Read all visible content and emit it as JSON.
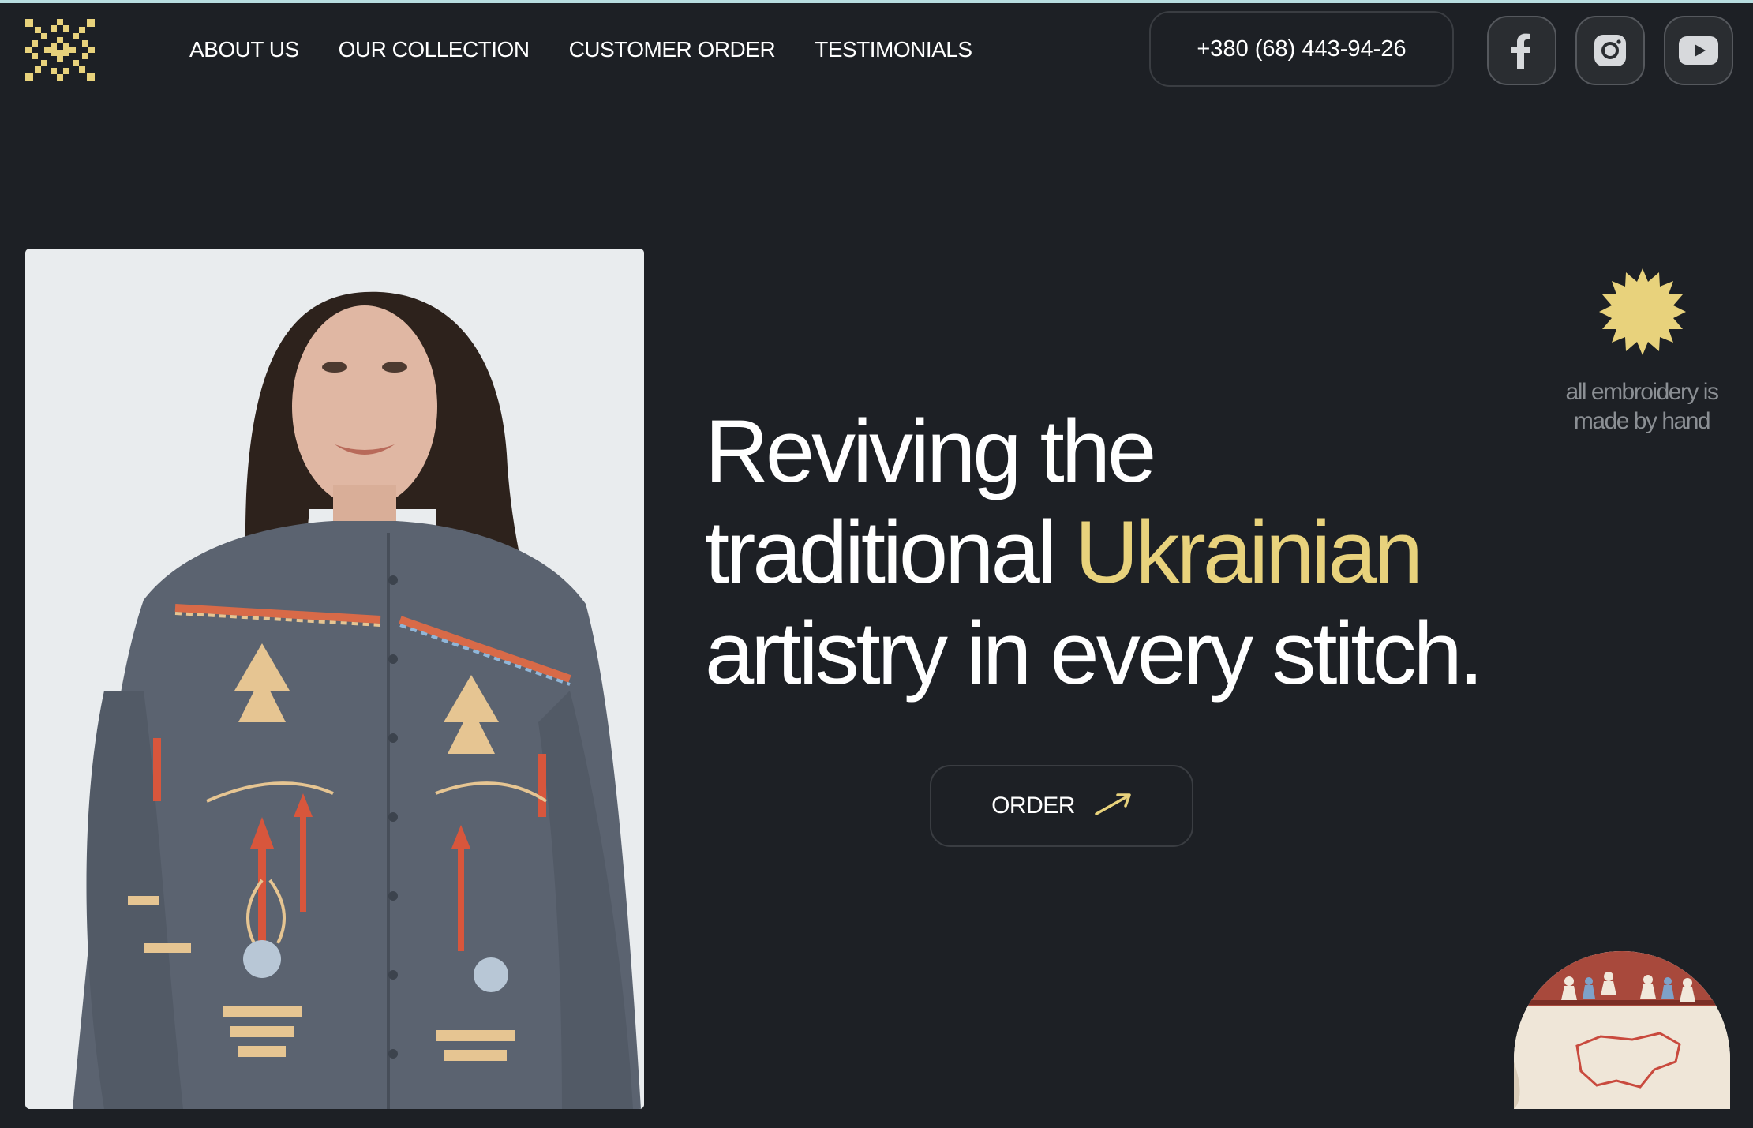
{
  "brand": {
    "logo_icon": "embroidery-ornament-logo",
    "accent_color": "#e8d27c",
    "background_color": "#1d2025"
  },
  "nav": {
    "items": [
      {
        "label": "ABOUT US"
      },
      {
        "label": "OUR COLLECTION"
      },
      {
        "label": "CUSTOMER ORDER"
      },
      {
        "label": "TESTIMONIALS"
      }
    ]
  },
  "contact": {
    "phone": "+380 (68) 443-94-26"
  },
  "social": [
    {
      "name": "facebook",
      "icon": "facebook-icon"
    },
    {
      "name": "instagram",
      "icon": "instagram-icon"
    },
    {
      "name": "youtube",
      "icon": "youtube-icon"
    }
  ],
  "hero": {
    "headline_line1": "Reviving the",
    "headline_line2_pre": "traditional ",
    "headline_accent": "Ukrainian",
    "headline_line3": "artistry in every stitch.",
    "order_label": "ORDER",
    "order_icon": "arrow-up-right-icon",
    "photo": "model-in-embroidered-shirt-photo"
  },
  "badge": {
    "icon": "sun-star-badge-icon",
    "text_line1": "all embroidery is",
    "text_line2": "made by hand"
  },
  "thumbnail": {
    "image": "embroidered-ukraine-map-thumbnail"
  }
}
